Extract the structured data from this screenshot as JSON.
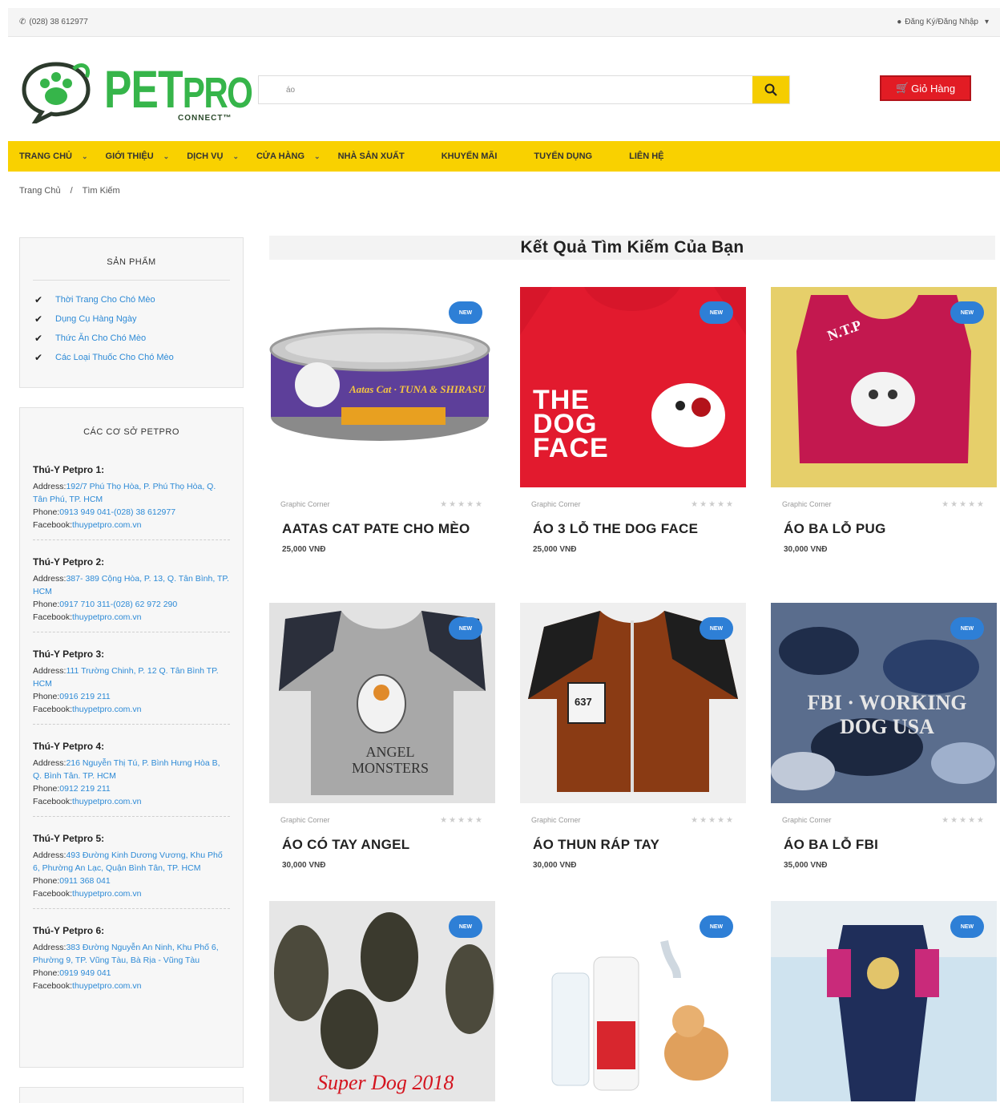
{
  "topbar": {
    "phone": "(028) 38 612977",
    "account": "Đăng Ký/Đăng Nhập"
  },
  "logo": {
    "word_a": "PET",
    "word_b": "PRO",
    "sub": "CONNECT™"
  },
  "search": {
    "value": "áo"
  },
  "cart": {
    "label": "Giỏ Hàng"
  },
  "nav": {
    "items": [
      "TRANG CHỦ",
      "GIỚI THIỆU",
      "DỊCH VỤ",
      "CỬA HÀNG",
      "NHÀ SẢN XUẤT",
      "KHUYẾN MÃI",
      "TUYỂN DỤNG",
      "LIÊN HỆ"
    ]
  },
  "breadcrumb": {
    "home": "Trang Chủ",
    "sep": "/",
    "current": "Tìm Kiếm"
  },
  "sidebar": {
    "products_title": "SẢN PHẨM",
    "categories": [
      "Thời Trang Cho Chó Mèo",
      "Dụng Cụ Hàng Ngày",
      "Thức Ăn Cho Chó Mèo",
      "Các Loại Thuốc Cho Chó Mèo"
    ],
    "branches_title": "CÁC CƠ SỞ PETPRO",
    "labels": {
      "address": "Address:",
      "phone": "Phone:",
      "facebook": "Facebook:"
    },
    "branches": [
      {
        "name": "Thú-Y Petpro 1:",
        "address": "192/7 Phú Thọ Hòa, P. Phú Thọ Hòa, Q. Tân Phú, TP. HCM",
        "phone": "0913 949 041-(028) 38 612977",
        "facebook": "thuypetpro.com.vn"
      },
      {
        "name": "Thú-Y Petpro 2:",
        "address": "387- 389 Cộng Hòa, P. 13, Q. Tân Bình, TP. HCM",
        "phone": "0917 710 311-(028) 62 972 290",
        "facebook": "thuypetpro.com.vn"
      },
      {
        "name": "Thú-Y Petpro 3:",
        "address": "111 Trường Chinh, P. 12 Q. Tân Bình TP. HCM",
        "phone": "0916 219 211",
        "facebook": "thuypetpro.com.vn"
      },
      {
        "name": "Thú-Y Petpro 4:",
        "address": "216 Nguyễn Thị Tú, P. Bình Hưng Hòa B, Q. Bình Tân. TP. HCM",
        "phone": "0912 219 211",
        "facebook": "thuypetpro.com.vn"
      },
      {
        "name": "Thú-Y Petpro 5:",
        "address": "493 Đường Kinh Dương Vương, Khu Phố 6, Phường An Lạc, Quận Bình Tân, TP. HCM",
        "phone": "0911 368 041",
        "facebook": "thuypetpro.com.vn"
      },
      {
        "name": "Thú-Y Petpro 6:",
        "address": "383 Đường Nguyễn An Ninh, Khu Phố 6, Phường 9, TP. Vũng Tàu, Bà Rịa - Vũng Tàu",
        "phone": "0919 949 041",
        "facebook": "thuypetpro.com.vn"
      }
    ]
  },
  "results": {
    "title": "Kết Quả Tìm Kiếm Của Bạn",
    "badge": "NEW",
    "vendor": "Graphic Corner",
    "stars": "★★★★★",
    "products": [
      {
        "name": "AATAS CAT PATE CHO MÈO",
        "price": "25,000 VNĐ",
        "img_text": "Aatas Cat · TUNA & SHIRASU"
      },
      {
        "name": "ÁO 3 LỖ THE DOG FACE",
        "price": "25,000 VNĐ",
        "img_text": "THE DOG FACE"
      },
      {
        "name": "ÁO BA LỖ PUG",
        "price": "30,000 VNĐ",
        "img_text": "N.T.P"
      },
      {
        "name": "ÁO CÓ TAY ANGEL",
        "price": "30,000 VNĐ",
        "img_text": "ANGEL MONSTERS"
      },
      {
        "name": "ÁO THUN RÁP TAY",
        "price": "30,000 VNĐ",
        "img_text": "637"
      },
      {
        "name": "ÁO BA LỖ FBI",
        "price": "35,000 VNĐ",
        "img_text": "FBI · WORKING DOG USA"
      },
      {
        "name": "",
        "price": "",
        "img_text": "Super Dog 2018"
      },
      {
        "name": "",
        "price": "",
        "img_text": ""
      },
      {
        "name": "",
        "price": "",
        "img_text": ""
      }
    ]
  },
  "colors": {
    "accent_yellow": "#f9d100",
    "cart_red": "#e21c24",
    "link_blue": "#2d8ad6",
    "badge_blue": "#2e7fd6",
    "brand_green": "#36b54a"
  }
}
